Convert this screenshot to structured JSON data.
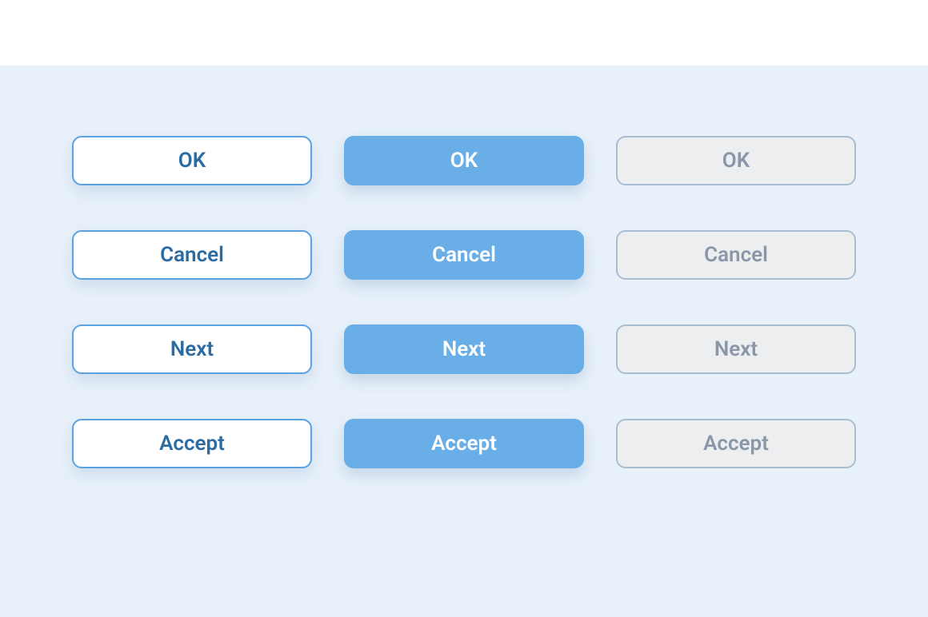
{
  "colors": {
    "pageBg": "#e8f1fa",
    "outlineBg": "#ffffff",
    "outlineText": "#2b6ca3",
    "outlineBorder": "#5aa2e0",
    "filledBg": "#6aaee8",
    "filledText": "#ffffff",
    "disabledBg": "#eceef0",
    "disabledText": "#8a97a8",
    "disabledBorder": "#a9bdd0"
  },
  "buttons": {
    "ok": "OK",
    "cancel": "Cancel",
    "next": "Next",
    "accept": "Accept"
  }
}
